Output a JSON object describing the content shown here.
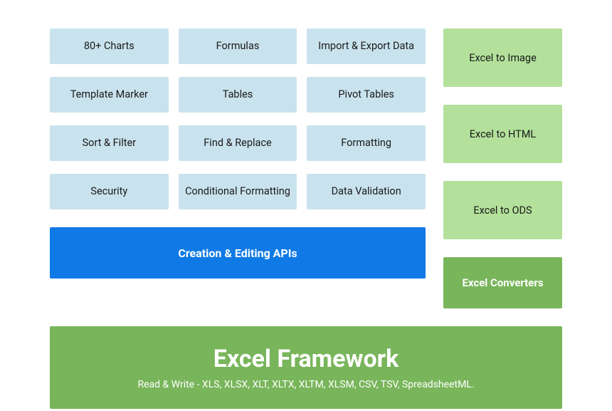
{
  "features": {
    "grid": [
      "80+ Charts",
      "Formulas",
      "Import & Export Data",
      "Template Marker",
      "Tables",
      "Pivot Tables",
      "Sort & Filter",
      "Find & Replace",
      "Formatting",
      "Security",
      "Conditional Formatting",
      "Data Validation"
    ],
    "header": "Creation & Editing APIs"
  },
  "converters": {
    "items": [
      "Excel to Image",
      "Excel to HTML",
      "Excel to ODS"
    ],
    "header": "Excel Converters"
  },
  "framework": {
    "title": "Excel Framework",
    "subtitle": "Read & Write - XLS, XLSX, XLT, XLTX, XLTM, XLSM, CSV, TSV, SpreadsheetML."
  }
}
